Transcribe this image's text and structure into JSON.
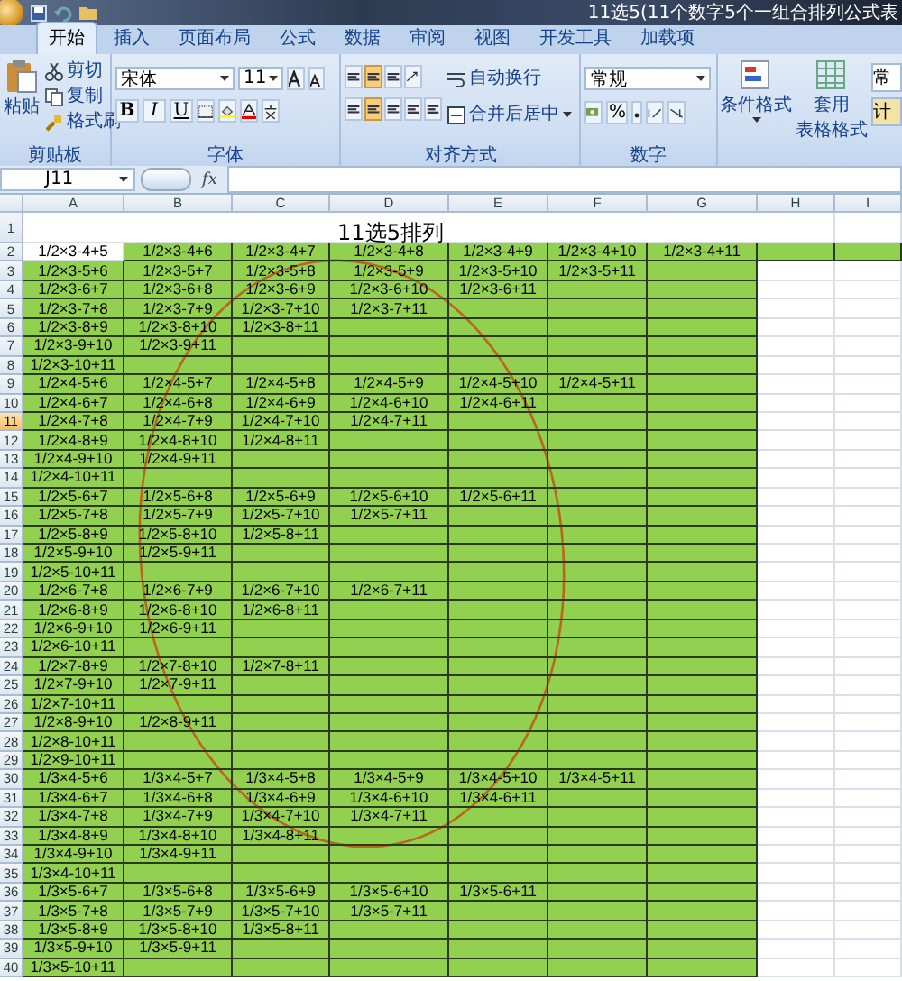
{
  "window": {
    "title": "11选5(11个数字5个一组合排列公式表"
  },
  "tabs": [
    {
      "label": "开始",
      "selected": true
    },
    {
      "label": "插入",
      "selected": false
    },
    {
      "label": "页面布局",
      "selected": false
    },
    {
      "label": "公式",
      "selected": false
    },
    {
      "label": "数据",
      "selected": false
    },
    {
      "label": "审阅",
      "selected": false
    },
    {
      "label": "视图",
      "selected": false
    },
    {
      "label": "开发工具",
      "selected": false
    },
    {
      "label": "加载项",
      "selected": false
    }
  ],
  "ribbon": {
    "clipboard": {
      "label": "剪贴板",
      "paste": "粘贴",
      "cut": "剪切",
      "copy": "复制",
      "format_painter": "格式刷"
    },
    "font": {
      "label": "字体",
      "font_name": "宋体",
      "font_size": "11",
      "bold": "B",
      "italic": "I",
      "underline": "U"
    },
    "alignment": {
      "label": "对齐方式",
      "wrap_text": "自动换行",
      "merge_center": "合并后居中"
    },
    "number": {
      "label": "数字",
      "format": "常规",
      "percent": "%"
    },
    "styles": {
      "conditional_formatting": "条件格式",
      "format_as_table": [
        "套用",
        "表格格式"
      ],
      "cell_styles": [
        "常",
        "计"
      ]
    }
  },
  "formula_bar": {
    "name_box": "J11",
    "function_label": "fx"
  },
  "sheet": {
    "title": "11选5排列",
    "columns": [
      "A",
      "B",
      "C",
      "D",
      "E",
      "F",
      "G",
      "H",
      "I"
    ],
    "rows": [
      {
        "number": "1",
        "selected": false,
        "kind": "title"
      },
      {
        "number": "2",
        "selected": false,
        "kind": "first",
        "cells": [
          "1/2×3-4+5",
          "1/2×3-4+6",
          "1/2×3-4+7",
          "1/2×3-4+8",
          "1/2×3-4+9",
          "1/2×3-4+10",
          "1/2×3-4+11"
        ]
      },
      {
        "number": "3",
        "selected": false,
        "kind": "data",
        "cells": [
          "1/2×3-5+6",
          "1/2×3-5+7",
          "1/2×3-5+8",
          "1/2×3-5+9",
          "1/2×3-5+10",
          "1/2×3-5+11"
        ]
      },
      {
        "number": "4",
        "selected": false,
        "kind": "data",
        "cells": [
          "1/2×3-6+7",
          "1/2×3-6+8",
          "1/2×3-6+9",
          "1/2×3-6+10",
          "1/2×3-6+11"
        ]
      },
      {
        "number": "5",
        "selected": false,
        "kind": "data",
        "cells": [
          "1/2×3-7+8",
          "1/2×3-7+9",
          "1/2×3-7+10",
          "1/2×3-7+11"
        ]
      },
      {
        "number": "6",
        "selected": false,
        "kind": "data",
        "cells": [
          "1/2×3-8+9",
          "1/2×3-8+10",
          "1/2×3-8+11"
        ]
      },
      {
        "number": "7",
        "selected": false,
        "kind": "data",
        "cells": [
          "1/2×3-9+10",
          "1/2×3-9+11"
        ]
      },
      {
        "number": "8",
        "selected": false,
        "kind": "data",
        "cells": [
          "1/2×3-10+11"
        ]
      },
      {
        "number": "9",
        "selected": false,
        "kind": "data",
        "cells": [
          "1/2×4-5+6",
          "1/2×4-5+7",
          "1/2×4-5+8",
          "1/2×4-5+9",
          "1/2×4-5+10",
          "1/2×4-5+11"
        ]
      },
      {
        "number": "10",
        "selected": false,
        "kind": "data",
        "cells": [
          "1/2×4-6+7",
          "1/2×4-6+8",
          "1/2×4-6+9",
          "1/2×4-6+10",
          "1/2×4-6+11"
        ]
      },
      {
        "number": "11",
        "selected": true,
        "kind": "data",
        "cells": [
          "1/2×4-7+8",
          "1/2×4-7+9",
          "1/2×4-7+10",
          "1/2×4-7+11"
        ]
      },
      {
        "number": "12",
        "selected": false,
        "kind": "data",
        "cells": [
          "1/2×4-8+9",
          "1/2×4-8+10",
          "1/2×4-8+11"
        ]
      },
      {
        "number": "13",
        "selected": false,
        "kind": "data",
        "cells": [
          "1/2×4-9+10",
          "1/2×4-9+11"
        ]
      },
      {
        "number": "14",
        "selected": false,
        "kind": "data",
        "cells": [
          "1/2×4-10+11"
        ]
      },
      {
        "number": "15",
        "selected": false,
        "kind": "data",
        "cells": [
          "1/2×5-6+7",
          "1/2×5-6+8",
          "1/2×5-6+9",
          "1/2×5-6+10",
          "1/2×5-6+11"
        ]
      },
      {
        "number": "16",
        "selected": false,
        "kind": "data",
        "cells": [
          "1/2×5-7+8",
          "1/2×5-7+9",
          "1/2×5-7+10",
          "1/2×5-7+11"
        ]
      },
      {
        "number": "17",
        "selected": false,
        "kind": "data",
        "cells": [
          "1/2×5-8+9",
          "1/2×5-8+10",
          "1/2×5-8+11"
        ]
      },
      {
        "number": "18",
        "selected": false,
        "kind": "data",
        "cells": [
          "1/2×5-9+10",
          "1/2×5-9+11"
        ]
      },
      {
        "number": "19",
        "selected": false,
        "kind": "data",
        "cells": [
          "1/2×5-10+11"
        ]
      },
      {
        "number": "20",
        "selected": false,
        "kind": "data",
        "cells": [
          "1/2×6-7+8",
          "1/2×6-7+9",
          "1/2×6-7+10",
          "1/2×6-7+11"
        ]
      },
      {
        "number": "21",
        "selected": false,
        "kind": "data",
        "cells": [
          "1/2×6-8+9",
          "1/2×6-8+10",
          "1/2×6-8+11"
        ]
      },
      {
        "number": "22",
        "selected": false,
        "kind": "data",
        "cells": [
          "1/2×6-9+10",
          "1/2×6-9+11"
        ]
      },
      {
        "number": "23",
        "selected": false,
        "kind": "data",
        "cells": [
          "1/2×6-10+11"
        ]
      },
      {
        "number": "24",
        "selected": false,
        "kind": "data",
        "cells": [
          "1/2×7-8+9",
          "1/2×7-8+10",
          "1/2×7-8+11"
        ]
      },
      {
        "number": "25",
        "selected": false,
        "kind": "data",
        "cells": [
          "1/2×7-9+10",
          "1/2×7-9+11"
        ]
      },
      {
        "number": "26",
        "selected": false,
        "kind": "data",
        "cells": [
          "1/2×7-10+11"
        ]
      },
      {
        "number": "27",
        "selected": false,
        "kind": "data",
        "cells": [
          "1/2×8-9+10",
          "1/2×8-9+11"
        ]
      },
      {
        "number": "28",
        "selected": false,
        "kind": "data",
        "cells": [
          "1/2×8-10+11"
        ]
      },
      {
        "number": "29",
        "selected": false,
        "kind": "data",
        "cells": [
          "1/2×9-10+11"
        ]
      },
      {
        "number": "30",
        "selected": false,
        "kind": "data",
        "cells": [
          "1/3×4-5+6",
          "1/3×4-5+7",
          "1/3×4-5+8",
          "1/3×4-5+9",
          "1/3×4-5+10",
          "1/3×4-5+11"
        ]
      },
      {
        "number": "31",
        "selected": false,
        "kind": "data",
        "cells": [
          "1/3×4-6+7",
          "1/3×4-6+8",
          "1/3×4-6+9",
          "1/3×4-6+10",
          "1/3×4-6+11"
        ]
      },
      {
        "number": "32",
        "selected": false,
        "kind": "data",
        "cells": [
          "1/3×4-7+8",
          "1/3×4-7+9",
          "1/3×4-7+10",
          "1/3×4-7+11"
        ]
      },
      {
        "number": "33",
        "selected": false,
        "kind": "data",
        "cells": [
          "1/3×4-8+9",
          "1/3×4-8+10",
          "1/3×4-8+11"
        ]
      },
      {
        "number": "34",
        "selected": false,
        "kind": "data",
        "cells": [
          "1/3×4-9+10",
          "1/3×4-9+11"
        ]
      },
      {
        "number": "35",
        "selected": false,
        "kind": "data",
        "cells": [
          "1/3×4-10+11"
        ]
      },
      {
        "number": "36",
        "selected": false,
        "kind": "data",
        "cells": [
          "1/3×5-6+7",
          "1/3×5-6+8",
          "1/3×5-6+9",
          "1/3×5-6+10",
          "1/3×5-6+11"
        ]
      },
      {
        "number": "37",
        "selected": false,
        "kind": "data",
        "cells": [
          "1/3×5-7+8",
          "1/3×5-7+9",
          "1/3×5-7+10",
          "1/3×5-7+11"
        ]
      },
      {
        "number": "38",
        "selected": false,
        "kind": "data",
        "cells": [
          "1/3×5-8+9",
          "1/3×5-8+10",
          "1/3×5-8+11"
        ]
      },
      {
        "number": "39",
        "selected": false,
        "kind": "data",
        "cells": [
          "1/3×5-9+10",
          "1/3×5-9+11"
        ]
      },
      {
        "number": "40",
        "selected": false,
        "kind": "data",
        "cells": [
          "1/3×5-10+11"
        ]
      }
    ]
  }
}
